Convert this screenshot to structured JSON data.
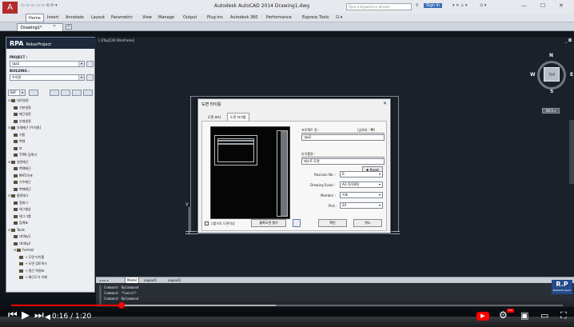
{
  "app": {
    "title": "Autodesk AutoCAD 2014    Drawing1.dwg",
    "logo_letter": "A",
    "search_placeholder": "Type a keyword or phrase",
    "sign_in": "Sign In",
    "window_controls": [
      "—",
      "☐",
      "✕"
    ]
  },
  "ribbon": {
    "tabs": [
      "Home",
      "Insert",
      "Annotate",
      "Layout",
      "Parametric",
      "View",
      "Manage",
      "Output",
      "Plug-ins",
      "Autodesk 360",
      "Performance",
      "Express Tools",
      "⊡ ▾"
    ],
    "active": "Home"
  },
  "file_tab": {
    "label": "Drawing1*",
    "close": "✕"
  },
  "panel": {
    "title": "RPA",
    "subtitle": "RebarProject",
    "project_label": "PROJECT :",
    "project_value": "rpa2",
    "building_label": "BUILDING :",
    "building_value": "우지원",
    "floor_value": "B2F",
    "tree": [
      {
        "label": "대기설정",
        "level": 0,
        "expand": "⊟"
      },
      {
        "label": "기본설정",
        "level": 1
      },
      {
        "label": "배근설정",
        "level": 1
      },
      {
        "label": "부재설정",
        "level": 1
      },
      {
        "label": "부재배근    [우지원]",
        "level": 0,
        "expand": "⊟"
      },
      {
        "label": "기둥",
        "level": 1
      },
      {
        "label": "벽체",
        "level": 1
      },
      {
        "label": "보",
        "level": 1
      },
      {
        "label": "TYPE 등록기",
        "level": 1
      },
      {
        "label": "일반배근",
        "level": 0,
        "expand": "⊟"
      },
      {
        "label": "벽체배근",
        "level": 1
      },
      {
        "label": "MAT/기초",
        "level": 1
      },
      {
        "label": "기수배근",
        "level": 1
      },
      {
        "label": "벽체배근",
        "level": 1
      },
      {
        "label": "물량태그",
        "level": 0,
        "expand": "⊟"
      },
      {
        "label": "정태그",
        "level": 1
      },
      {
        "label": "태그형상",
        "level": 1
      },
      {
        "label": "태그그룹",
        "level": 1
      },
      {
        "label": "집계표",
        "level": 1
      },
      {
        "label": "Tools",
        "level": 0,
        "expand": "⊟"
      },
      {
        "label": "Utility1",
        "level": 1
      },
      {
        "label": "Utility2",
        "level": 1
      },
      {
        "label": "Format",
        "level": 1,
        "expand": "⊟"
      },
      {
        "label": "→ 도면 타이틀",
        "level": 2
      },
      {
        "label": "→ 도면 검토박스",
        "level": 2
      },
      {
        "label": "→ 절곤 박용표",
        "level": 2
      },
      {
        "label": "→ 배근도식 삭제",
        "level": 2
      }
    ]
  },
  "viewport": {
    "label": "[-][Top][2D Wireframe]",
    "minimize": "_ ◘",
    "compass": {
      "n": "N",
      "s": "S",
      "e": "E",
      "w": "W",
      "top": "TOP",
      "wcs": "WCS ▾"
    },
    "ucs_y": "Y"
  },
  "dialog": {
    "title": "도면 타이틀",
    "close": "✕",
    "tabs": [
      "도면 표지",
      "도면 타이틀"
    ],
    "active_tab": "도면 타이틀",
    "project_name_label": "프로젝트 명 :",
    "unit_label": "(금위자 : ₩)",
    "project_name_value": "rpa2",
    "reset_label": "Reset",
    "title_label": "타이틀명 :",
    "title_value": "테스트 도면",
    "revision_label": "Revision No. :",
    "revision_value": "0",
    "scale_label": "Drawing Scale :",
    "scale_value": "A3 (1/100)",
    "member_label": "Member :",
    "member_value": "기초",
    "pick_label": "Pick :",
    "pick_value": "24",
    "group_check_label": "그룹으로 도면작성",
    "open_button": "블록도면 열기",
    "ok_button": "확인",
    "cancel_button": "취소"
  },
  "layout_tabs": [
    "Model",
    "Layout1",
    "Layout2"
  ],
  "command_lines": [
    "Command: RpCommand",
    "Command: *Cancel*",
    "Command: RpCommand"
  ],
  "rp_logo": {
    "text": "R.P",
    "sub": "RebarProject"
  },
  "video": {
    "timecode": "0:16 / 1:20",
    "played_fraction": 0.2,
    "loaded_fraction": 0.48,
    "hd": "HD"
  }
}
